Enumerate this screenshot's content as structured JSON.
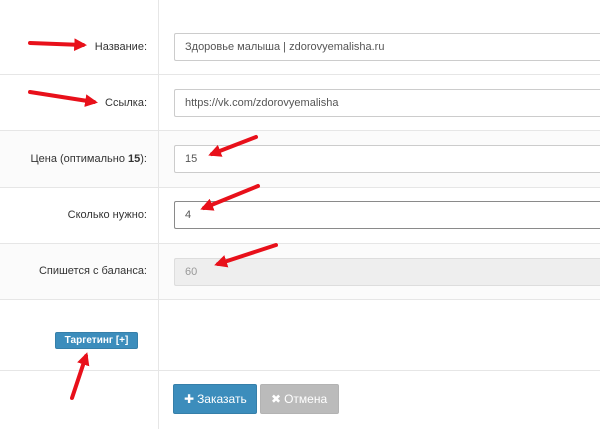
{
  "form": {
    "name_label": "Название:",
    "name_value": "Здоровье малыша | zdorovyemalisha.ru",
    "link_label": "Ссылка:",
    "link_value": "https://vk.com/zdorovyemalisha",
    "price_label_prefix": "Цена (оптимально ",
    "price_label_optimal": "15",
    "price_label_suffix": "):",
    "price_value": "15",
    "count_label": "Сколько нужно:",
    "count_value": "4",
    "debit_label": "Спишется с баланса:",
    "debit_value": "60"
  },
  "targeting": {
    "button_label": "Таргетинг [+]"
  },
  "actions": {
    "order_label": "Заказать",
    "cancel_label": "Отмена"
  },
  "colors": {
    "primary": "#3c8dbc",
    "default_button": "#bbbbbb",
    "annotation_arrow": "#e8101a"
  },
  "icons": {
    "order": "plus-icon",
    "cancel": "close-icon"
  }
}
